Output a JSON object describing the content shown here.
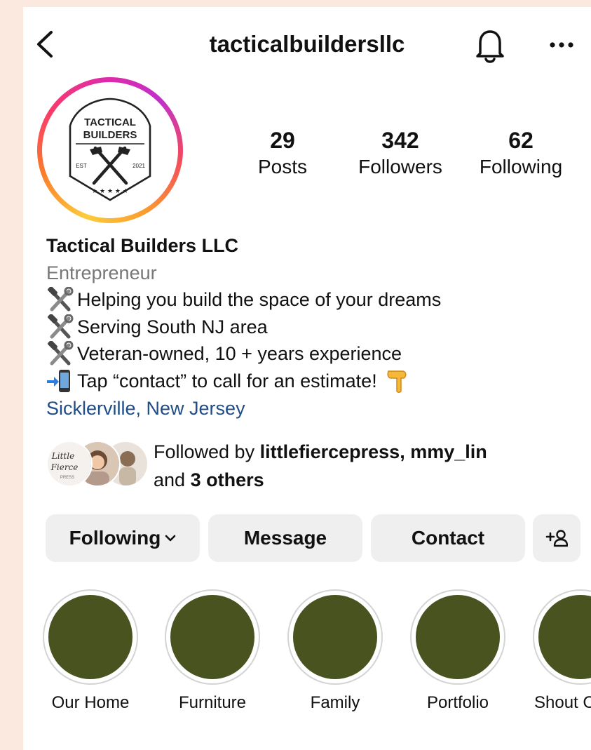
{
  "header": {
    "username": "tacticalbuildersllc"
  },
  "avatar": {
    "logo_line1": "TACTICAL",
    "logo_line2": "BUILDERS",
    "logo_est": "EST",
    "logo_year": "2021"
  },
  "stats": [
    {
      "value": "29",
      "label": "Posts"
    },
    {
      "value": "342",
      "label": "Followers"
    },
    {
      "value": "62",
      "label": "Following"
    }
  ],
  "bio": {
    "name": "Tactical Builders LLC",
    "category": "Entrepreneur",
    "lines": [
      {
        "icon": "hammer-wrench-icon",
        "text": "Helping you build the space of your dreams"
      },
      {
        "icon": "hammer-wrench-icon",
        "text": "Serving South NJ area"
      },
      {
        "icon": "hammer-wrench-icon",
        "text": "Veteran-owned, 10 + years experience"
      },
      {
        "icon": "phone-arrow-icon",
        "text": "Tap “contact” to call for an estimate!"
      }
    ],
    "pointing_icon": "pointing-down-icon",
    "location": "Sicklerville, New Jersey"
  },
  "followed_by": {
    "prefix": "Followed by",
    "users": "littlefiercepress, mmy_lin",
    "and": "and",
    "others": "3 others",
    "avatar_text_1": "Little",
    "avatar_text_2": "Fierce",
    "avatar_text_3": "PRESS"
  },
  "buttons": {
    "following": "Following",
    "message": "Message",
    "contact": "Contact"
  },
  "highlights": [
    {
      "label": "Our Home"
    },
    {
      "label": "Furniture"
    },
    {
      "label": "Family"
    },
    {
      "label": "Portfolio"
    },
    {
      "label": "Shout C"
    }
  ],
  "colors": {
    "highlight_fill": "#48531f",
    "link": "#204d87",
    "button_bg": "#efefef",
    "page_bg": "#fbe9df"
  }
}
